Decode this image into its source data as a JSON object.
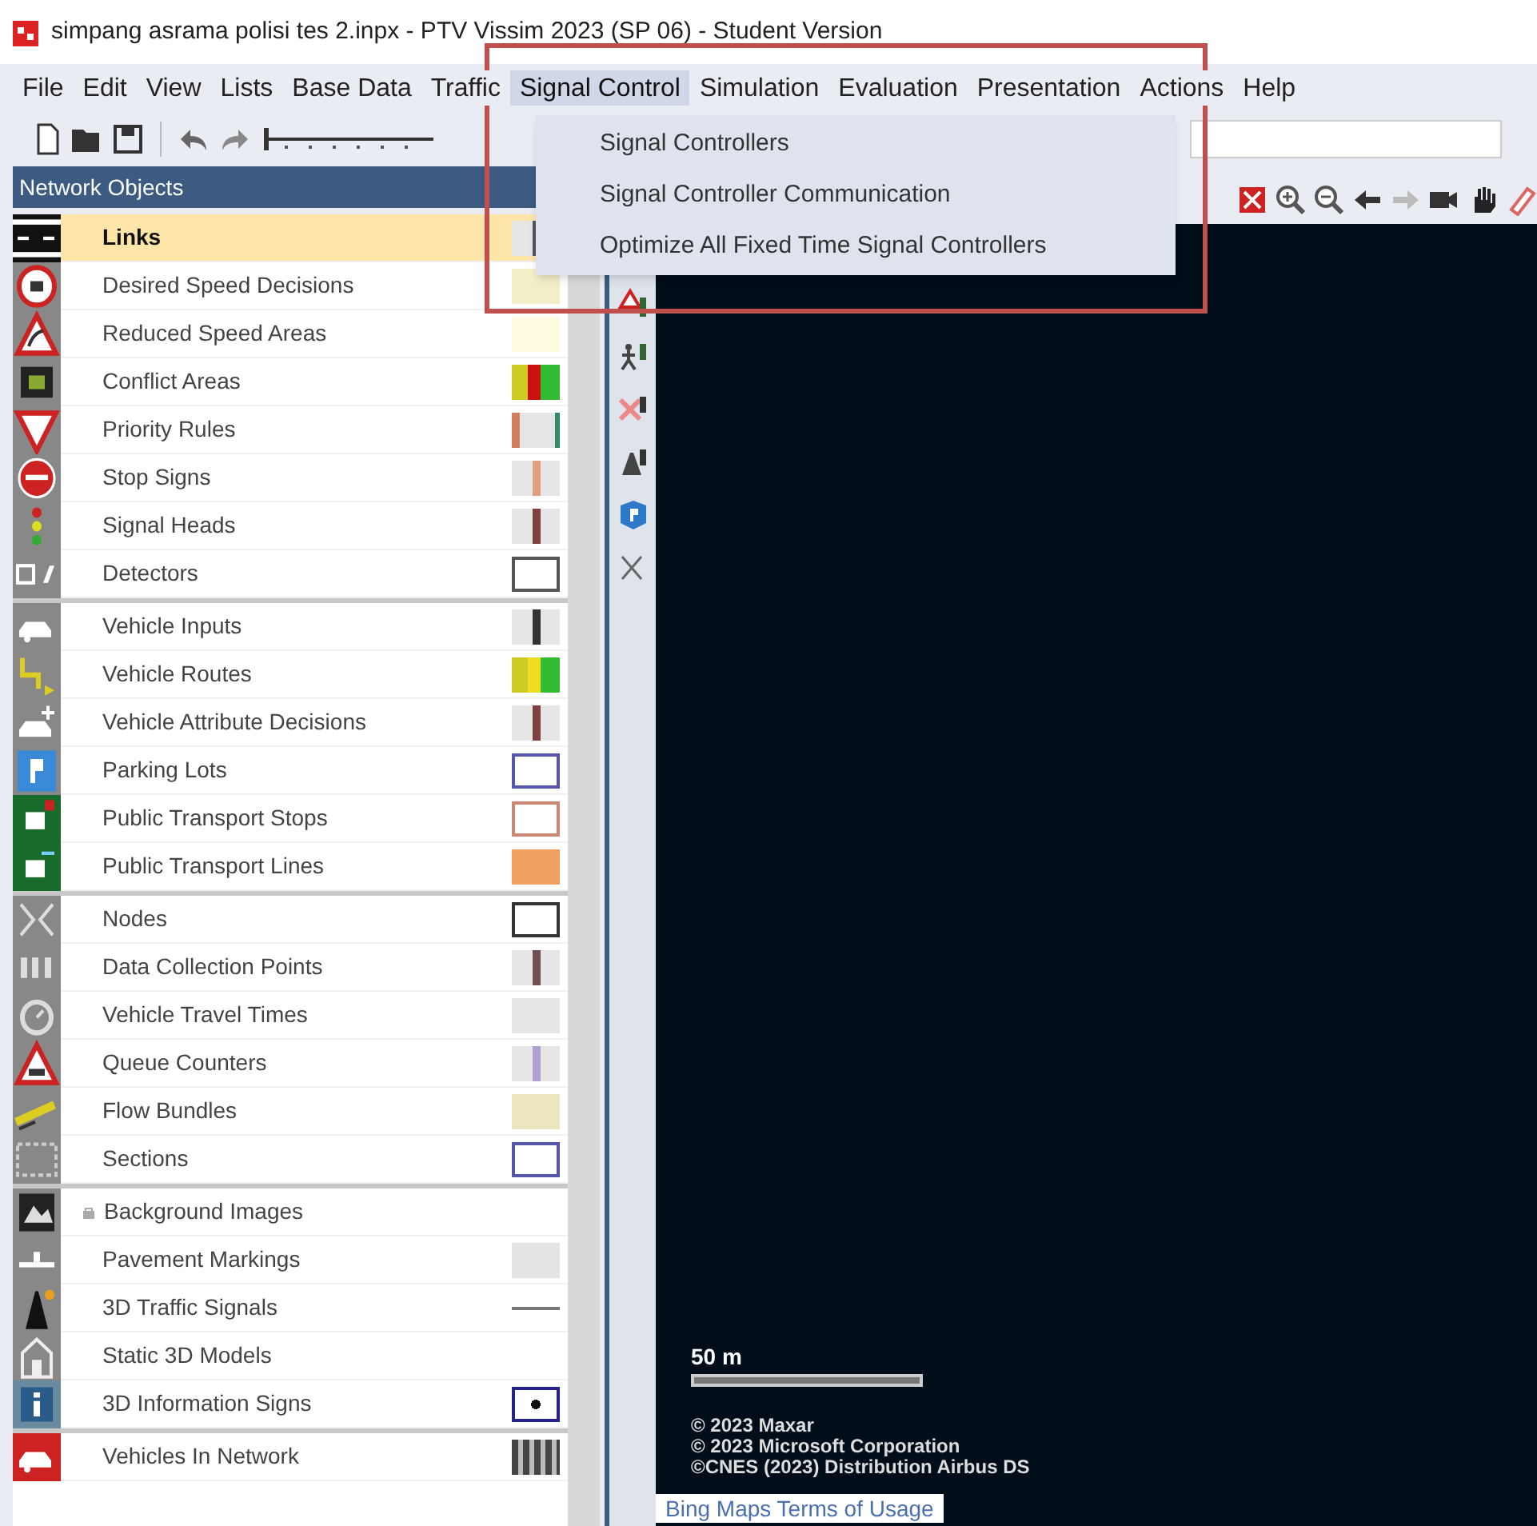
{
  "window": {
    "title": "simpang asrama polisi tes 2.inpx - PTV Vissim 2023 (SP 06) - Student Version"
  },
  "menu": [
    {
      "label": "File",
      "selected": false
    },
    {
      "label": "Edit",
      "selected": false
    },
    {
      "label": "View",
      "selected": false
    },
    {
      "label": "Lists",
      "selected": false
    },
    {
      "label": "Base Data",
      "selected": false
    },
    {
      "label": "Traffic",
      "selected": false
    },
    {
      "label": "Signal Control",
      "selected": true
    },
    {
      "label": "Simulation",
      "selected": false
    },
    {
      "label": "Evaluation",
      "selected": false
    },
    {
      "label": "Presentation",
      "selected": false
    },
    {
      "label": "Actions",
      "selected": false
    },
    {
      "label": "Help",
      "selected": false
    }
  ],
  "dropdown": [
    "Signal Controllers",
    "Signal Controller Communication",
    "Optimize All Fixed Time Signal Controllers"
  ],
  "panel": {
    "title": "Network Objects",
    "groups": [
      [
        {
          "label": "Links",
          "selected": true,
          "kind": "bar",
          "color": "#555555"
        },
        {
          "label": "Desired Speed Decisions",
          "selected": false,
          "kind": "fill",
          "color": "#f3efc8"
        },
        {
          "label": "Reduced Speed Areas",
          "selected": false,
          "kind": "fill",
          "color": "#fffbe0"
        },
        {
          "label": "Conflict Areas",
          "selected": false,
          "kind": "tricolor",
          "color": "#cc1111"
        },
        {
          "label": "Priority Rules",
          "selected": false,
          "kind": "edges",
          "color": "#d08060"
        },
        {
          "label": "Stop Signs",
          "selected": false,
          "kind": "bar",
          "color": "#e0a080"
        },
        {
          "label": "Signal Heads",
          "selected": false,
          "kind": "bar",
          "color": "#804040"
        },
        {
          "label": "Detectors",
          "selected": false,
          "kind": "outline",
          "color": "#555555"
        }
      ],
      [
        {
          "label": "Vehicle Inputs",
          "selected": false,
          "kind": "bar",
          "color": "#333333"
        },
        {
          "label": "Vehicle Routes",
          "selected": false,
          "kind": "tricolor",
          "color": "#eedd22"
        },
        {
          "label": "Vehicle Attribute Decisions",
          "selected": false,
          "kind": "bar",
          "color": "#804040"
        },
        {
          "label": "Parking Lots",
          "selected": false,
          "kind": "outline",
          "color": "#5555aa"
        },
        {
          "label": "Public Transport Stops",
          "selected": false,
          "kind": "outline",
          "color": "#cc8877"
        },
        {
          "label": "Public Transport Lines",
          "selected": false,
          "kind": "fill",
          "color": "#f0a060"
        }
      ],
      [
        {
          "label": "Nodes",
          "selected": false,
          "kind": "outline",
          "color": "#333333"
        },
        {
          "label": "Data Collection Points",
          "selected": false,
          "kind": "bar",
          "color": "#705050"
        },
        {
          "label": "Vehicle Travel Times",
          "selected": false,
          "kind": "fill",
          "color": "#e6e6e6"
        },
        {
          "label": "Queue Counters",
          "selected": false,
          "kind": "bar",
          "color": "#b0a0d0"
        },
        {
          "label": "Flow Bundles",
          "selected": false,
          "kind": "fill",
          "color": "#ece6c0"
        },
        {
          "label": "Sections",
          "selected": false,
          "kind": "outline",
          "color": "#5555aa"
        }
      ],
      [
        {
          "label": "Background Images",
          "selected": false,
          "kind": "none"
        },
        {
          "label": "Pavement Markings",
          "selected": false,
          "kind": "fill",
          "color": "#e4e4e4"
        },
        {
          "label": "3D Traffic Signals",
          "selected": false,
          "kind": "pin",
          "color": "#777777"
        },
        {
          "label": "Static 3D Models",
          "selected": false,
          "kind": "none"
        },
        {
          "label": "3D Information Signs",
          "selected": false,
          "kind": "info",
          "color": "#222288"
        }
      ],
      [
        {
          "label": "Vehicles In Network",
          "selected": false,
          "kind": "stripes",
          "color": "#444444"
        }
      ]
    ]
  },
  "map": {
    "scale": "50 m",
    "attribution": [
      "© 2023 Maxar",
      "© 2023 Microsoft Corporation",
      "©CNES (2023) Distribution Airbus DS"
    ],
    "terms_link": "Bing Maps Terms of Usage"
  }
}
